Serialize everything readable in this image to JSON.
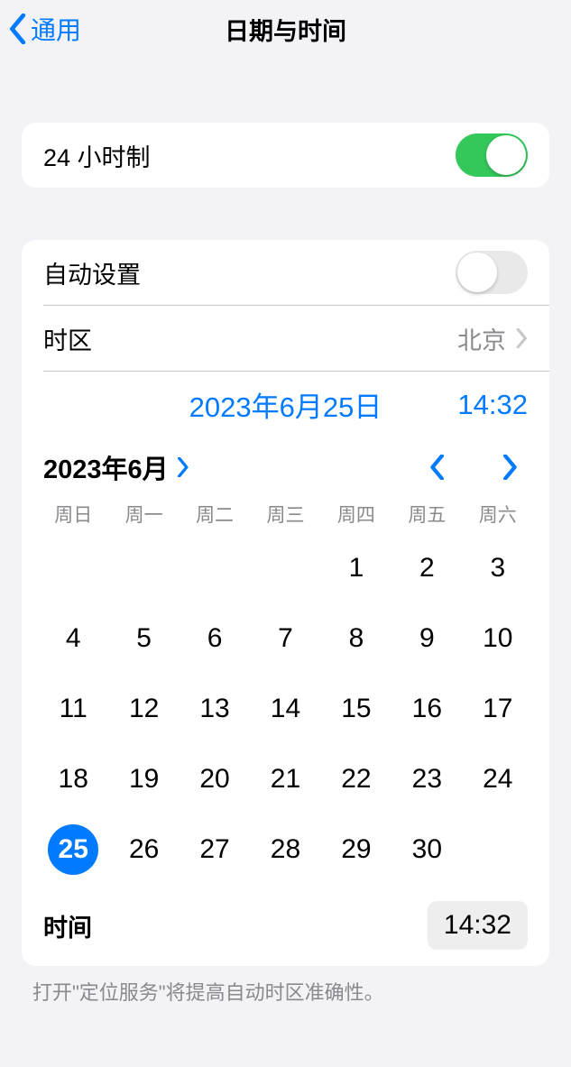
{
  "nav": {
    "back_label": "通用",
    "title": "日期与时间"
  },
  "section1": {
    "twentyfour_label": "24 小时制",
    "twentyfour_on": true
  },
  "section2": {
    "auto_label": "自动设置",
    "auto_on": false,
    "timezone_label": "时区",
    "timezone_value": "北京",
    "selected_date_display": "2023年6月25日",
    "selected_time_display": "14:32"
  },
  "calendar": {
    "month_label": "2023年6月",
    "weekdays": [
      "周日",
      "周一",
      "周二",
      "周三",
      "周四",
      "周五",
      "周六"
    ],
    "leading_blanks": 4,
    "days_in_month": 30,
    "selected_day": 25
  },
  "time_row": {
    "label": "时间",
    "value": "14:32"
  },
  "footer": {
    "note": "打开\"定位服务\"将提高自动时区准确性。"
  }
}
